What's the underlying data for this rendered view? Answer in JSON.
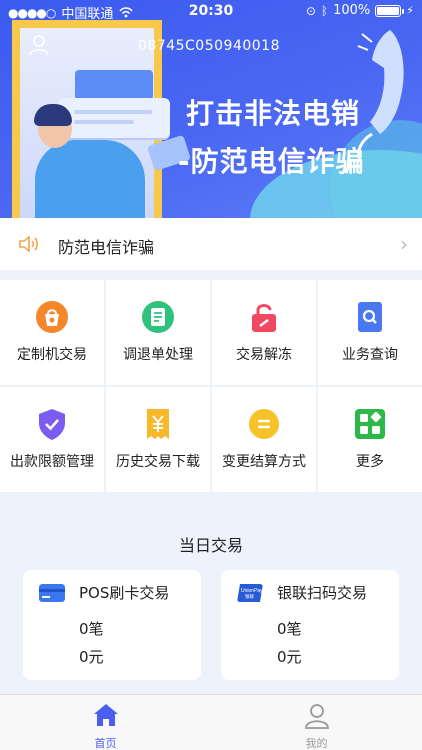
{
  "status_bar": {
    "carrier": "中国联通",
    "time": "20:30",
    "battery": "100%"
  },
  "banner": {
    "merchant_id": "08745C050940018",
    "slogan_line1": "打击非法电销",
    "slogan_line2": "-防范电信诈骗"
  },
  "notice": {
    "text": "防范电信诈骗"
  },
  "functions": [
    {
      "label": "定制机交易",
      "icon": "bag-icon",
      "color": "#f5862a"
    },
    {
      "label": "调退单处理",
      "icon": "document-icon",
      "color": "#2fc27d"
    },
    {
      "label": "交易解冻",
      "icon": "unlock-icon",
      "color": "#f04a63"
    },
    {
      "label": "业务查询",
      "icon": "search-doc-icon",
      "color": "#4a78f0"
    },
    {
      "label": "出款限额管理",
      "icon": "shield-check-icon",
      "color": "#7b5cf0"
    },
    {
      "label": "历史交易下载",
      "icon": "receipt-yen-icon",
      "color": "#f7b82a"
    },
    {
      "label": "变更结算方式",
      "icon": "exchange-icon",
      "color": "#f7c22a"
    },
    {
      "label": "更多",
      "icon": "apps-grid-icon",
      "color": "#2fb84a"
    }
  ],
  "today": {
    "title": "当日交易",
    "cards": [
      {
        "title": "POS刷卡交易",
        "count": "0笔",
        "amount": "0元",
        "icon": "card-icon",
        "color": "#3b78f0"
      },
      {
        "title": "银联扫码交易",
        "count": "0笔",
        "amount": "0元",
        "icon": "unionpay-icon",
        "color": "#2a5bd6",
        "logo_text": "UnionPay 银联"
      }
    ]
  },
  "tabbar": {
    "home_label": "首页",
    "mine_label": "我的",
    "active_color": "#4a5ef0",
    "inactive_color": "#999999"
  }
}
